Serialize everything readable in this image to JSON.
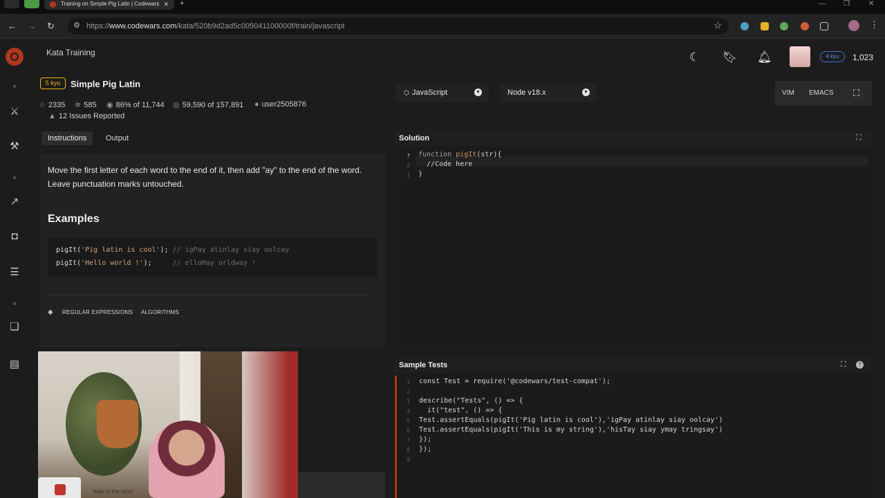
{
  "browser": {
    "tab_title": "Training on Simple Pig Latin | Codewars",
    "url_prefix": "https://",
    "url_domain": "www.codewars.com",
    "url_path": "/kata/520b9d2ad5c005041100000f/train/javascript"
  },
  "header": {
    "section": "Kata Training",
    "rank_badge": "4 kyu",
    "honor": "1,023"
  },
  "kata": {
    "kyu": "5 kyu",
    "title": "Simple Pig Latin",
    "stars": "2335",
    "collections": "585",
    "satisfaction": "86% of 11,744",
    "completed": "59,590 of 157,891",
    "author": "user2505876",
    "issues": "12 Issues Reported"
  },
  "tabs": [
    {
      "label": "Instructions",
      "active": true
    },
    {
      "label": "Output",
      "active": false
    }
  ],
  "instructions": {
    "description": "Move the first letter of each word to the end of it, then add \"ay\" to the end of the word. Leave punctuation marks untouched.",
    "examples_title": "Examples",
    "examples": [
      {
        "call": "pigIt(",
        "arg": "'Pig latin is cool'",
        "close": "); ",
        "comment": "// igPay atinlay siay oolcay"
      },
      {
        "call": "pigIt(",
        "arg": "'Hello world !'",
        "close": ");     ",
        "comment": "// elloHay orldway !"
      }
    ],
    "tags": [
      "REGULAR EXPRESSIONS",
      "ALGORITHMS"
    ]
  },
  "video": {
    "caption": "Kata is the most"
  },
  "editor_toolbar": {
    "language": "JavaScript",
    "runtime": "Node v18.x",
    "vim_label": "VIM",
    "emacs_label": "EMACS"
  },
  "solution": {
    "title": "Solution",
    "lines": [
      {
        "num": "1",
        "kw": "function ",
        "fn": "pigIt",
        "rest": "(str){"
      },
      {
        "num": "2",
        "kw": "",
        "fn": "",
        "rest": "  //Code here"
      },
      {
        "num": "3",
        "kw": "",
        "fn": "",
        "rest": "}"
      }
    ]
  },
  "sample_tests": {
    "title": "Sample Tests",
    "lines": [
      {
        "num": "1",
        "text": "const Test = require('@codewars/test-compat');"
      },
      {
        "num": "2",
        "text": ""
      },
      {
        "num": "3",
        "text": "describe(\"Tests\", () => {"
      },
      {
        "num": "4",
        "text": "  it(\"test\", () => {"
      },
      {
        "num": "5",
        "text": "Test.assertEquals(pigIt('Pig latin is cool'),'igPay atinlay siay oolcay')"
      },
      {
        "num": "6",
        "text": "Test.assertEquals(pigIt('This is my string'),'hisTay siay ymay tringsay')"
      },
      {
        "num": "7",
        "text": "});"
      },
      {
        "num": "8",
        "text": "});"
      },
      {
        "num": "9",
        "text": ""
      }
    ]
  },
  "colors": {
    "brand": "#b1361e",
    "kyu": "#ecb613",
    "rank": "#3b74d9"
  },
  "icons": [
    "back-icon",
    "forward-icon",
    "reload-icon",
    "star-icon",
    "moon-icon",
    "bookmark-icon",
    "bell-icon",
    "tag-icon",
    "warning-icon",
    "user-icon",
    "fullscreen-icon",
    "help-icon"
  ]
}
